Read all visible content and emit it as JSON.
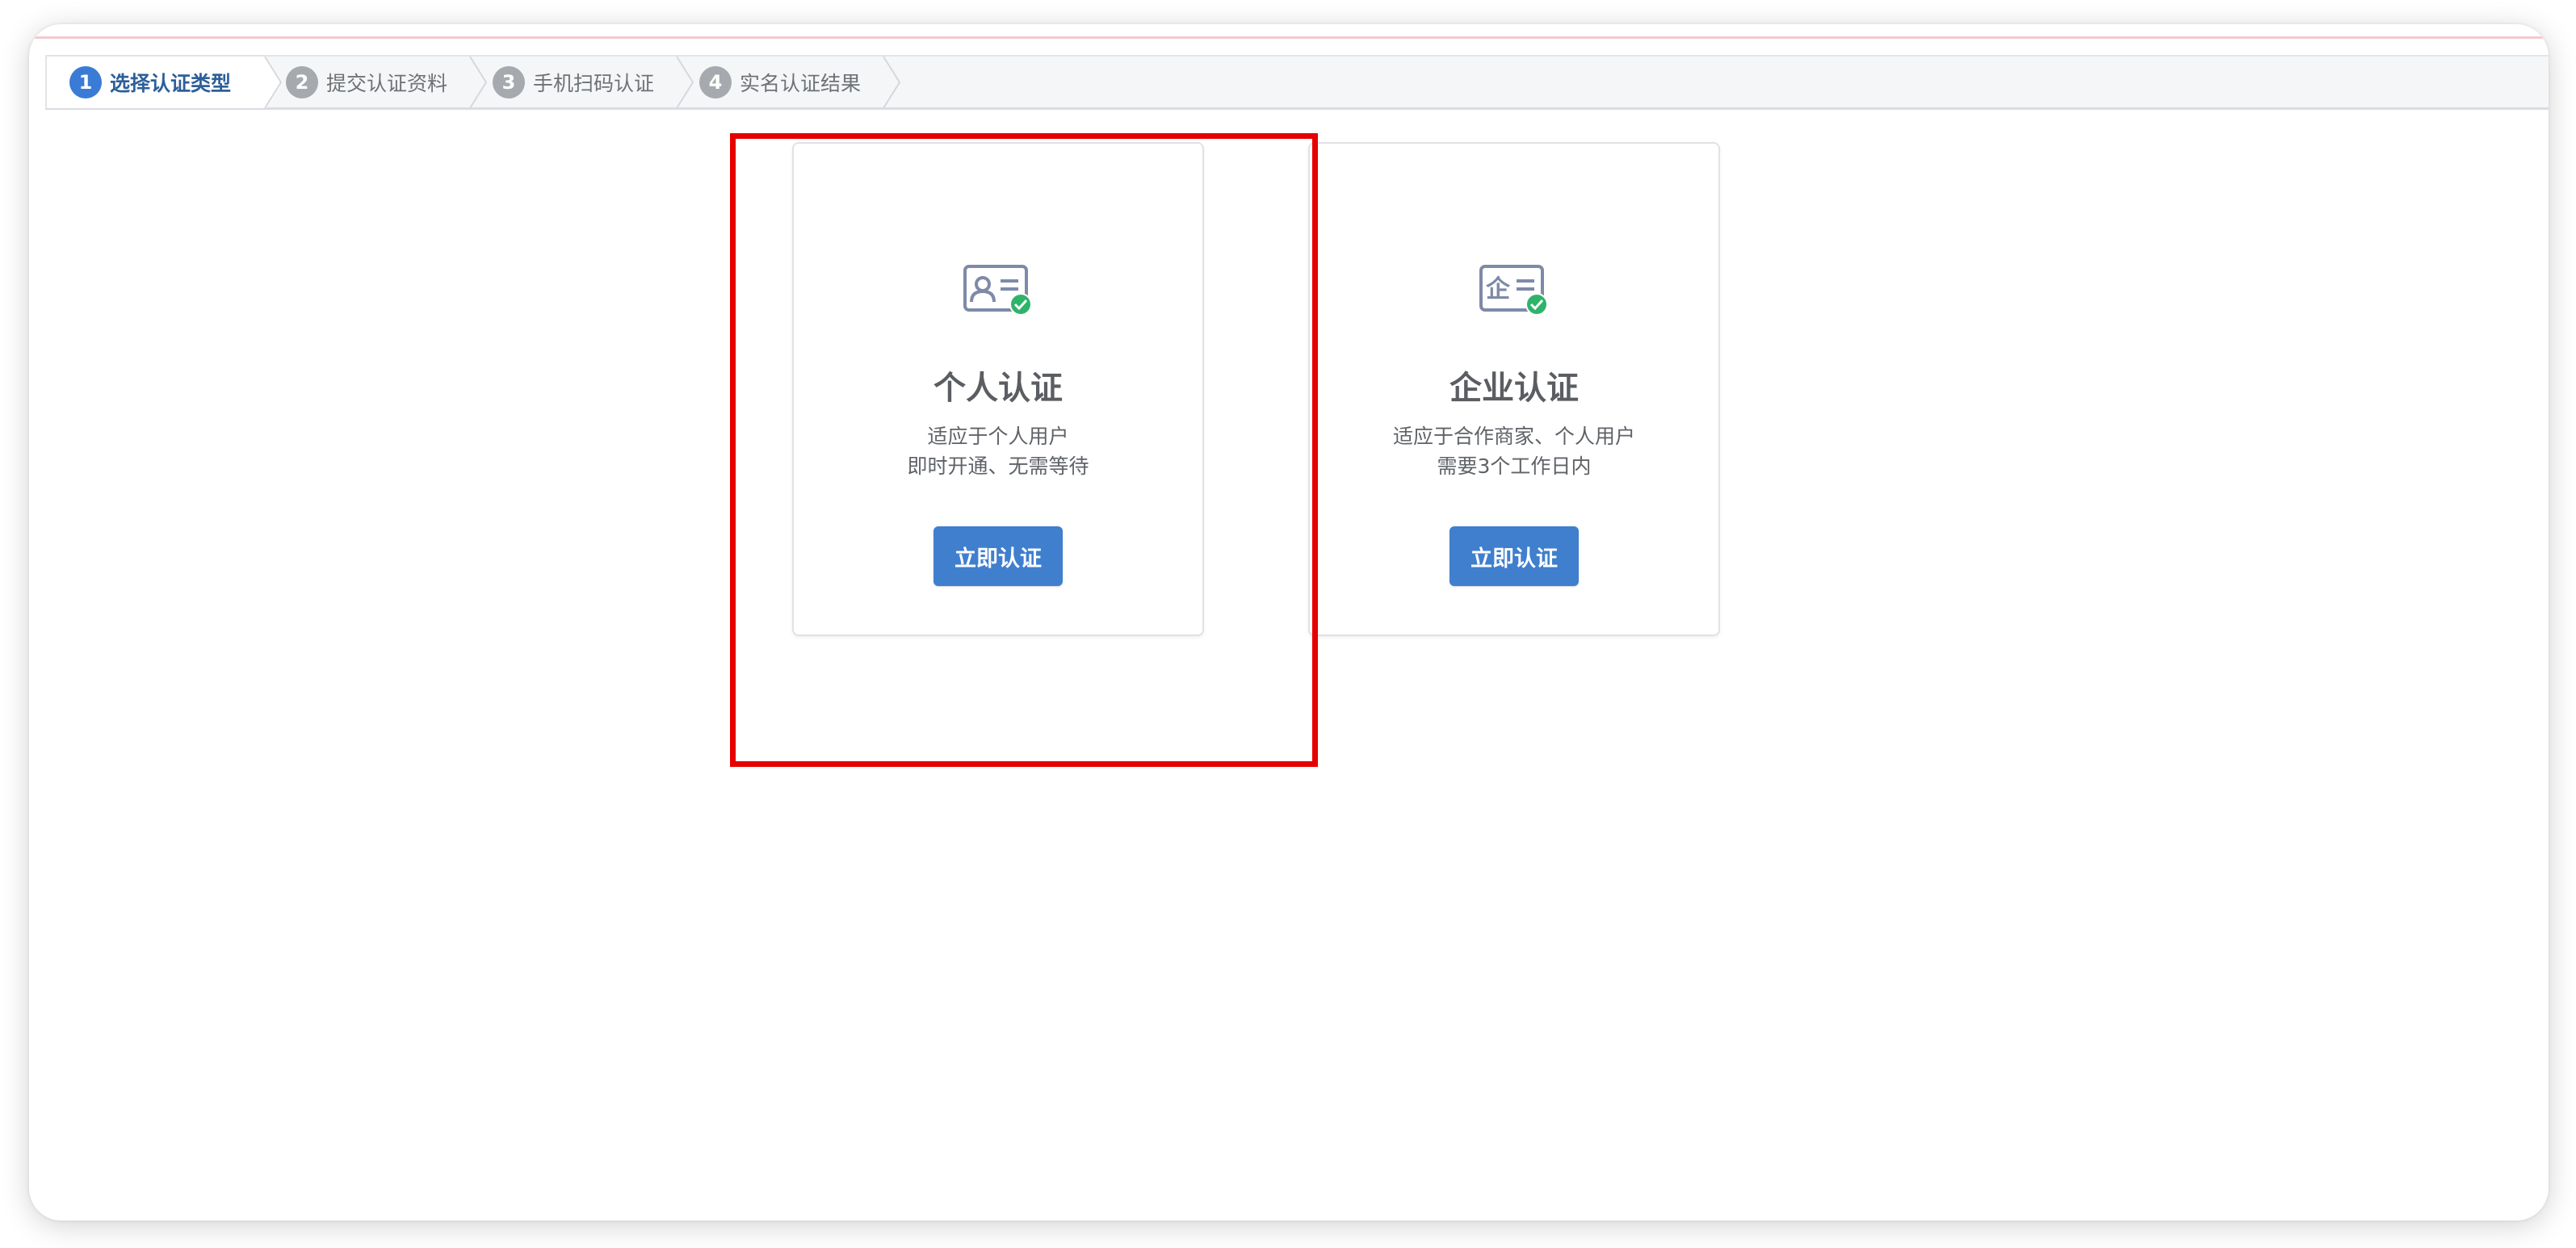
{
  "steps": [
    {
      "number": "1",
      "label": "选择认证类型",
      "active": true
    },
    {
      "number": "2",
      "label": "提交认证资料",
      "active": false
    },
    {
      "number": "3",
      "label": "手机扫码认证",
      "active": false
    },
    {
      "number": "4",
      "label": "实名认证结果",
      "active": false
    }
  ],
  "cards": {
    "personal": {
      "icon": "id-card-person-check-icon",
      "title": "个人认证",
      "desc_line1": "适应于个人用户",
      "desc_line2": "即时开通、无需等待",
      "button_label": "立即认证"
    },
    "enterprise": {
      "icon": "id-card-enterprise-check-icon",
      "icon_glyph": "企",
      "title": "企业认证",
      "desc_line1": "适应于合作商家、个人用户",
      "desc_line2": "需要3个工作日内",
      "button_label": "立即认证"
    }
  },
  "colors": {
    "accent": "#3f7fce",
    "step_active": "#3a7bd5",
    "step_inactive": "#a6a9ad",
    "check": "#2fb36b",
    "highlight": "#e60000"
  }
}
